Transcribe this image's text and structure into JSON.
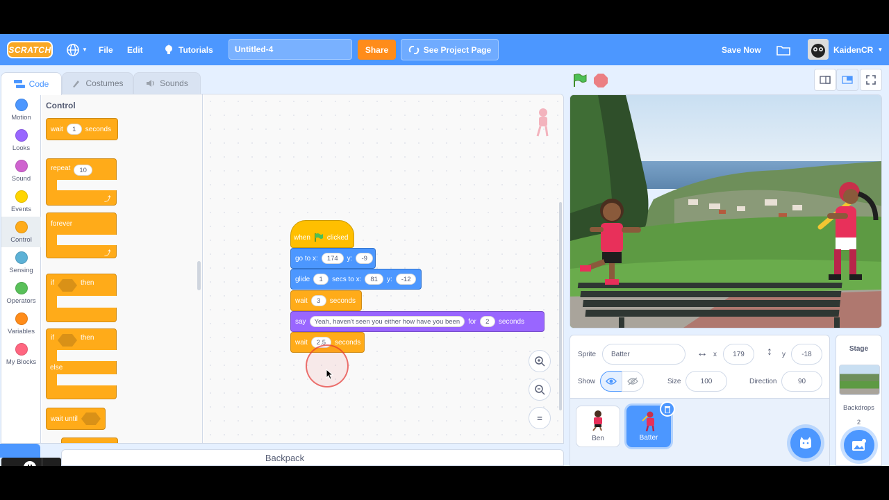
{
  "menu": {
    "logo_text": "SCRATCH",
    "file": "File",
    "edit": "Edit",
    "tutorials": "Tutorials",
    "project_title": "Untitled-4",
    "share": "Share",
    "see_project_page": "See Project Page",
    "save_now": "Save Now",
    "username": "KaidenCR"
  },
  "tabs": {
    "code": "Code",
    "costumes": "Costumes",
    "sounds": "Sounds"
  },
  "categories": [
    {
      "label": "Motion",
      "color": "#4c97ff"
    },
    {
      "label": "Looks",
      "color": "#9966ff"
    },
    {
      "label": "Sound",
      "color": "#cf63cf"
    },
    {
      "label": "Events",
      "color": "#ffd500"
    },
    {
      "label": "Control",
      "color": "#ffab19"
    },
    {
      "label": "Sensing",
      "color": "#5cb1d6"
    },
    {
      "label": "Operators",
      "color": "#59c059"
    },
    {
      "label": "Variables",
      "color": "#ff8c1a"
    },
    {
      "label": "My Blocks",
      "color": "#ff6680"
    }
  ],
  "palette": {
    "title": "Control",
    "wait": {
      "word": "wait",
      "value": "1",
      "unit": "seconds"
    },
    "repeat": {
      "word": "repeat",
      "value": "10"
    },
    "forever": "forever",
    "if_then": {
      "if": "if",
      "then": "then"
    },
    "if_else": {
      "if": "if",
      "then": "then",
      "else": "else"
    },
    "wait_until": "wait until"
  },
  "script": {
    "hat": {
      "when": "when",
      "clicked": "clicked"
    },
    "goto": {
      "label": "go to x:",
      "x": "174",
      "ylabel": "y:",
      "y": "-9"
    },
    "glide": {
      "label": "glide",
      "secs": "1",
      "secs_to": "secs to x:",
      "x": "81",
      "ylabel": "y:",
      "y": "-12"
    },
    "wait1": {
      "label": "wait",
      "value": "3",
      "unit": "seconds"
    },
    "say": {
      "label": "say",
      "text": "Yeah, haven't seen you either how have you been",
      "for": "for",
      "value": "2",
      "unit": "seconds"
    },
    "wait2": {
      "label": "wait",
      "value": "2.5",
      "unit": "seconds"
    }
  },
  "zoom": {
    "in": "+",
    "out": "−",
    "reset": "="
  },
  "backpack": "Backpack",
  "sprite_info": {
    "sprite_label": "Sprite",
    "sprite_name": "Batter",
    "x_label": "x",
    "x": "179",
    "y_label": "y",
    "y": "-18",
    "show_label": "Show",
    "size_label": "Size",
    "size": "100",
    "direction_label": "Direction",
    "direction": "90"
  },
  "sprites": [
    {
      "name": "Ben",
      "selected": false
    },
    {
      "name": "Batter",
      "selected": true
    }
  ],
  "stage_panel": {
    "title": "Stage",
    "backdrops_label": "Backdrops",
    "backdrops_count": "2"
  },
  "colors": {
    "accent": "#4c97ff",
    "control": "#ffab19",
    "events": "#ffbf00",
    "looks": "#9966ff",
    "share": "#ff8c1a"
  }
}
